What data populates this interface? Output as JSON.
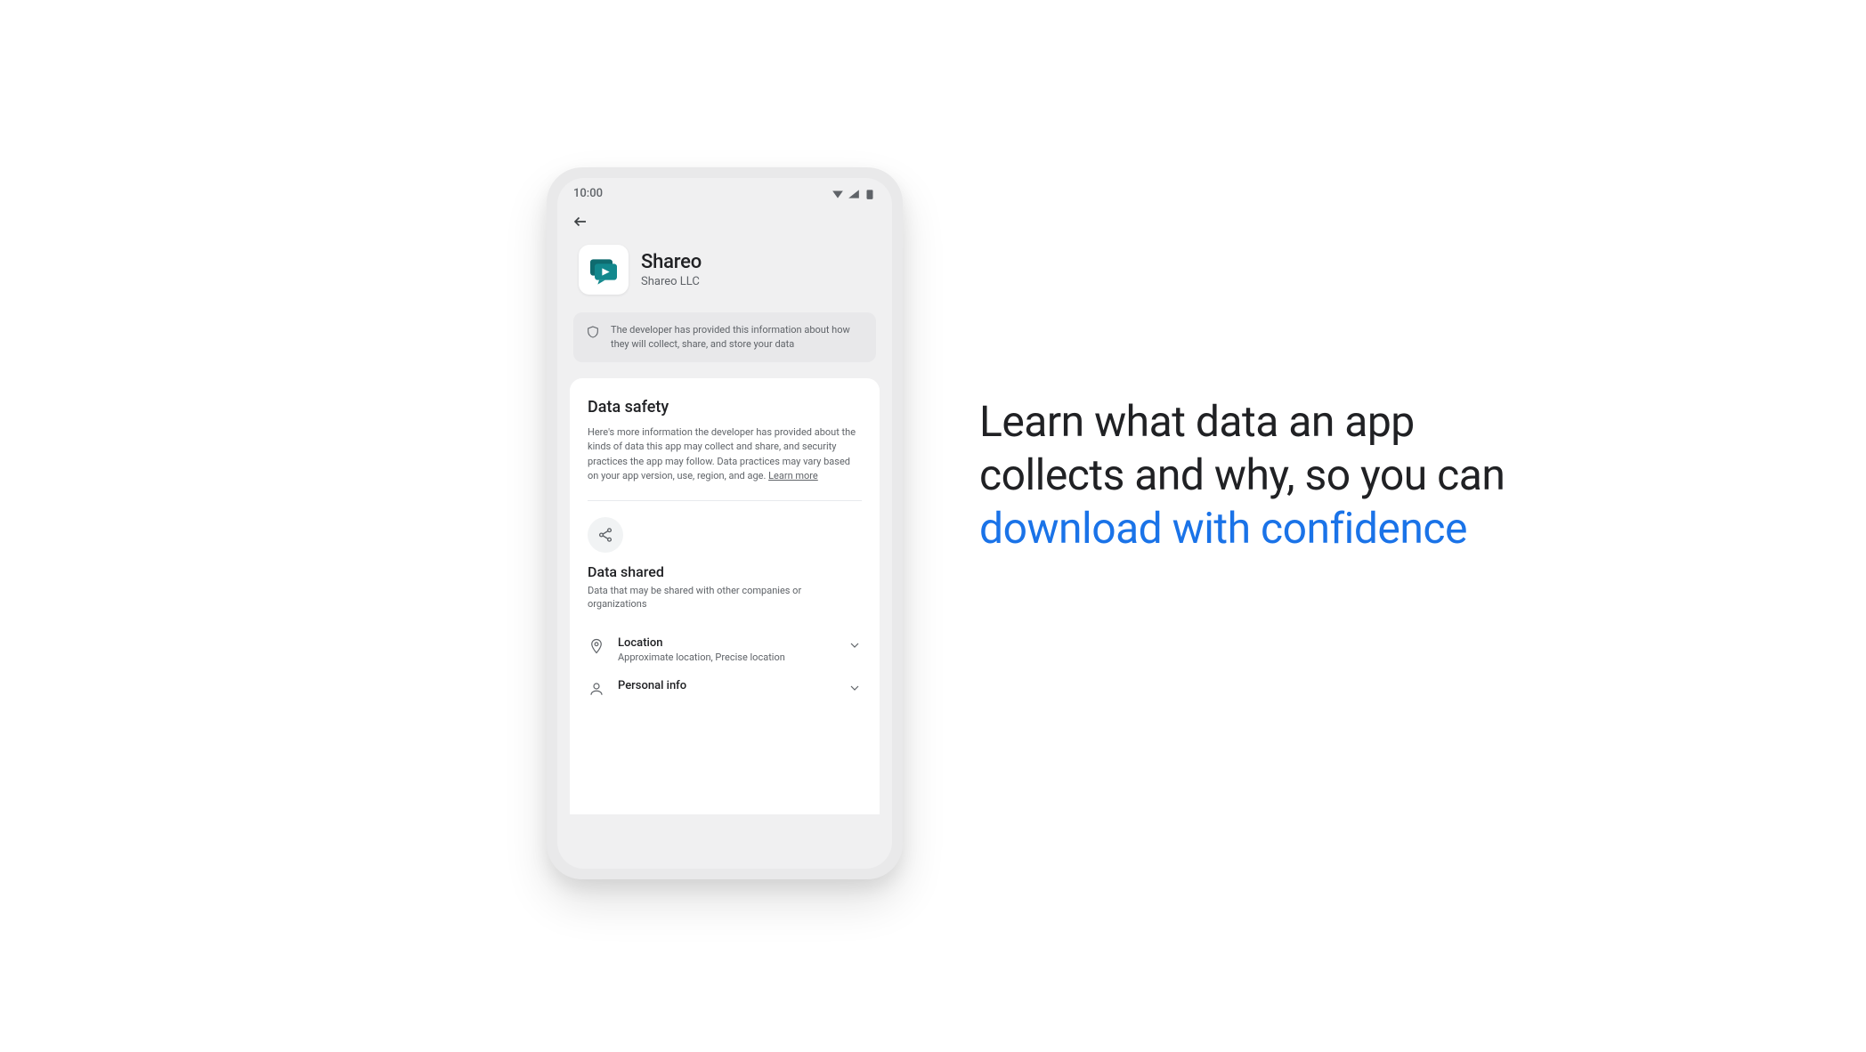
{
  "status": {
    "time": "10:00"
  },
  "app": {
    "name": "Shareo",
    "developer": "Shareo LLC"
  },
  "banner": {
    "text": "The developer has provided this information about how they will collect, share, and store your data"
  },
  "data_safety": {
    "title": "Data safety",
    "description": "Here's more information the developer has provided about the kinds of data this app may collect and share, and security practices the app may follow. Data practices may vary based on your app version, use, region, and age. ",
    "learn_more": "Learn more"
  },
  "data_shared": {
    "title": "Data shared",
    "subtitle": "Data that may be shared with other companies or organizations",
    "rows": [
      {
        "label": "Location",
        "detail": "Approximate location, Precise location"
      },
      {
        "label": "Personal info",
        "detail": ""
      }
    ]
  },
  "headline": {
    "line1": "Learn what data an app",
    "line2": "collects and why, so you can",
    "accent": "download with confidence"
  }
}
